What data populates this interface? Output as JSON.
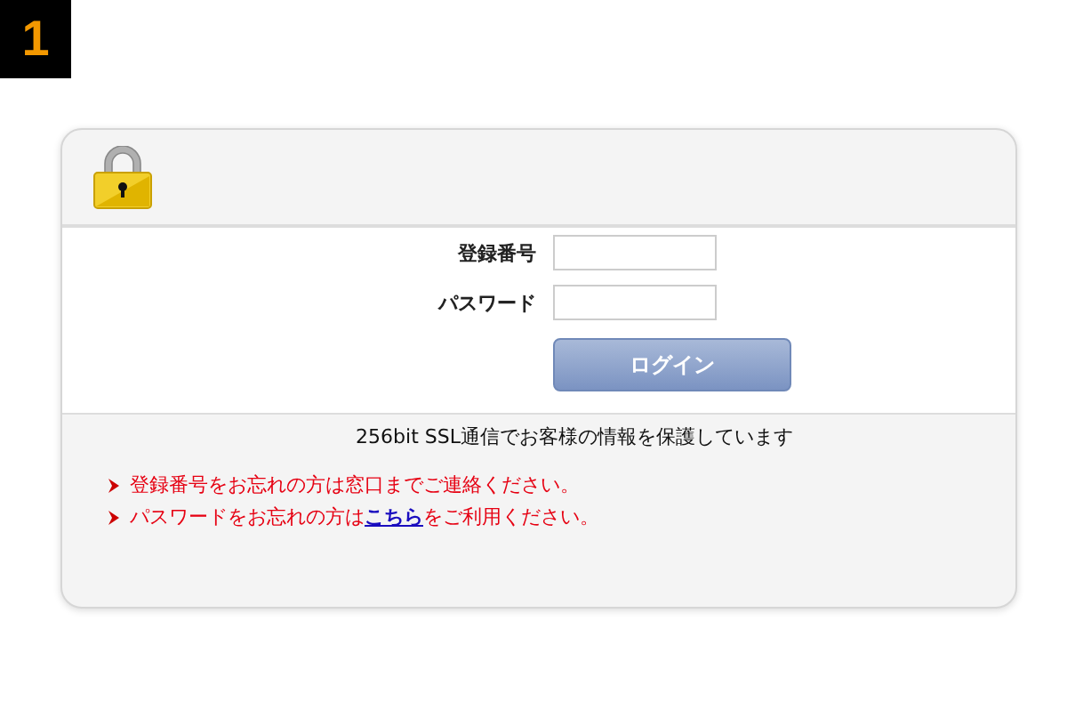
{
  "step_badge": "1",
  "form": {
    "fields": [
      {
        "label": "登録番号"
      },
      {
        "label": "パスワード"
      }
    ],
    "submit": "ログイン"
  },
  "security_note": "256bit SSL通信でお客様の情報を保護しています",
  "notes": [
    {
      "kind": "plain",
      "text": "登録番号をお忘れの方は窓口までご連絡ください。"
    },
    {
      "kind": "link",
      "before": "パスワードをお忘れの方は",
      "link": "こちら",
      "after": "をご利用ください。"
    }
  ]
}
